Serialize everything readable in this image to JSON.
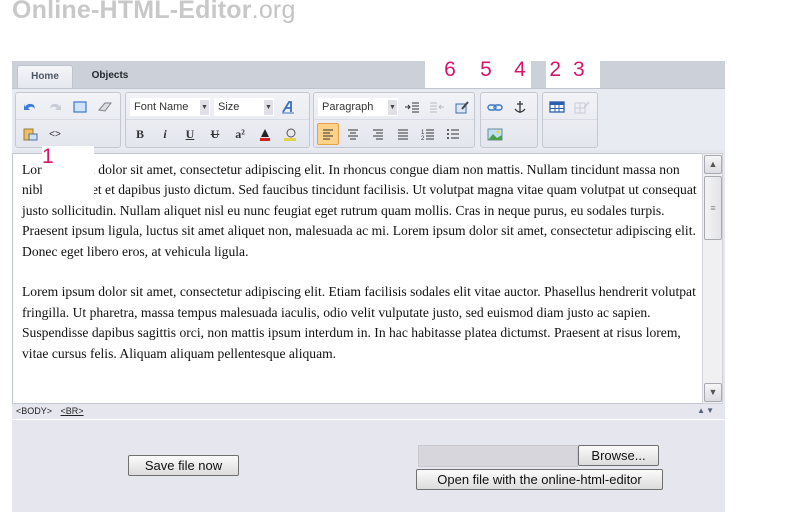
{
  "site": {
    "name": "Online-HTML-Editor",
    "tld": ".org"
  },
  "tabs": [
    {
      "label": "Home",
      "active": true
    },
    {
      "label": "Objects",
      "active": false
    }
  ],
  "toolbar": {
    "edit_group": [
      "undo-icon",
      "redo-icon",
      "select-all-icon",
      "eraser-icon",
      "paste-icon",
      "source-code-icon"
    ],
    "source_code_glyph": "<>",
    "font_name": "Font Name",
    "font_size": "Size",
    "paragraph": "Paragraph",
    "format_buttons": {
      "bold": "B",
      "italic": "i",
      "underline": "U",
      "strike": "U",
      "superscript": "a²"
    },
    "active_alignment": "align-left"
  },
  "annotations": [
    "1",
    "2",
    "3",
    "4",
    "5",
    "6"
  ],
  "content": {
    "paragraphs": [
      "Lorem ipsum dolor sit amet, consectetur adipiscing elit. In rhoncus congue diam non mattis. Nullam tincidunt massa non nibh imperdiet et dapibus justo dictum. Sed faucibus tincidunt facilisis. Ut volutpat magna vitae quam volutpat ut consequat justo sollicitudin. Nullam aliquet nisl eu nunc feugiat eget rutrum quam mollis. Cras in neque purus, eu sodales turpis. Praesent ipsum ligula, luctus sit amet aliquet non, malesuada ac mi. Lorem ipsum dolor sit amet, consectetur adipiscing elit. Donec eget libero eros, at vehicula ligula.",
      "Lorem ipsum dolor sit amet, consectetur adipiscing elit. Etiam facilisis sodales elit vitae auctor. Phasellus hendrerit volutpat fringilla. Ut pharetra, massa tempus malesuada iaculis, odio velit vulputate justo, sed euismod diam justo ac sapien. Suspendisse dapibus sagittis orci, non mattis ipsum interdum in. In hac habitasse platea dictumst. Praesent at risus lorem, vitae cursus felis. Aliquam aliquam pellentesque aliquam."
    ]
  },
  "status_bar": {
    "path": [
      "<BODY>",
      "<BR>"
    ]
  },
  "actions": {
    "save": "Save file now",
    "browse": "Browse...",
    "open": "Open file with the online-html-editor"
  }
}
